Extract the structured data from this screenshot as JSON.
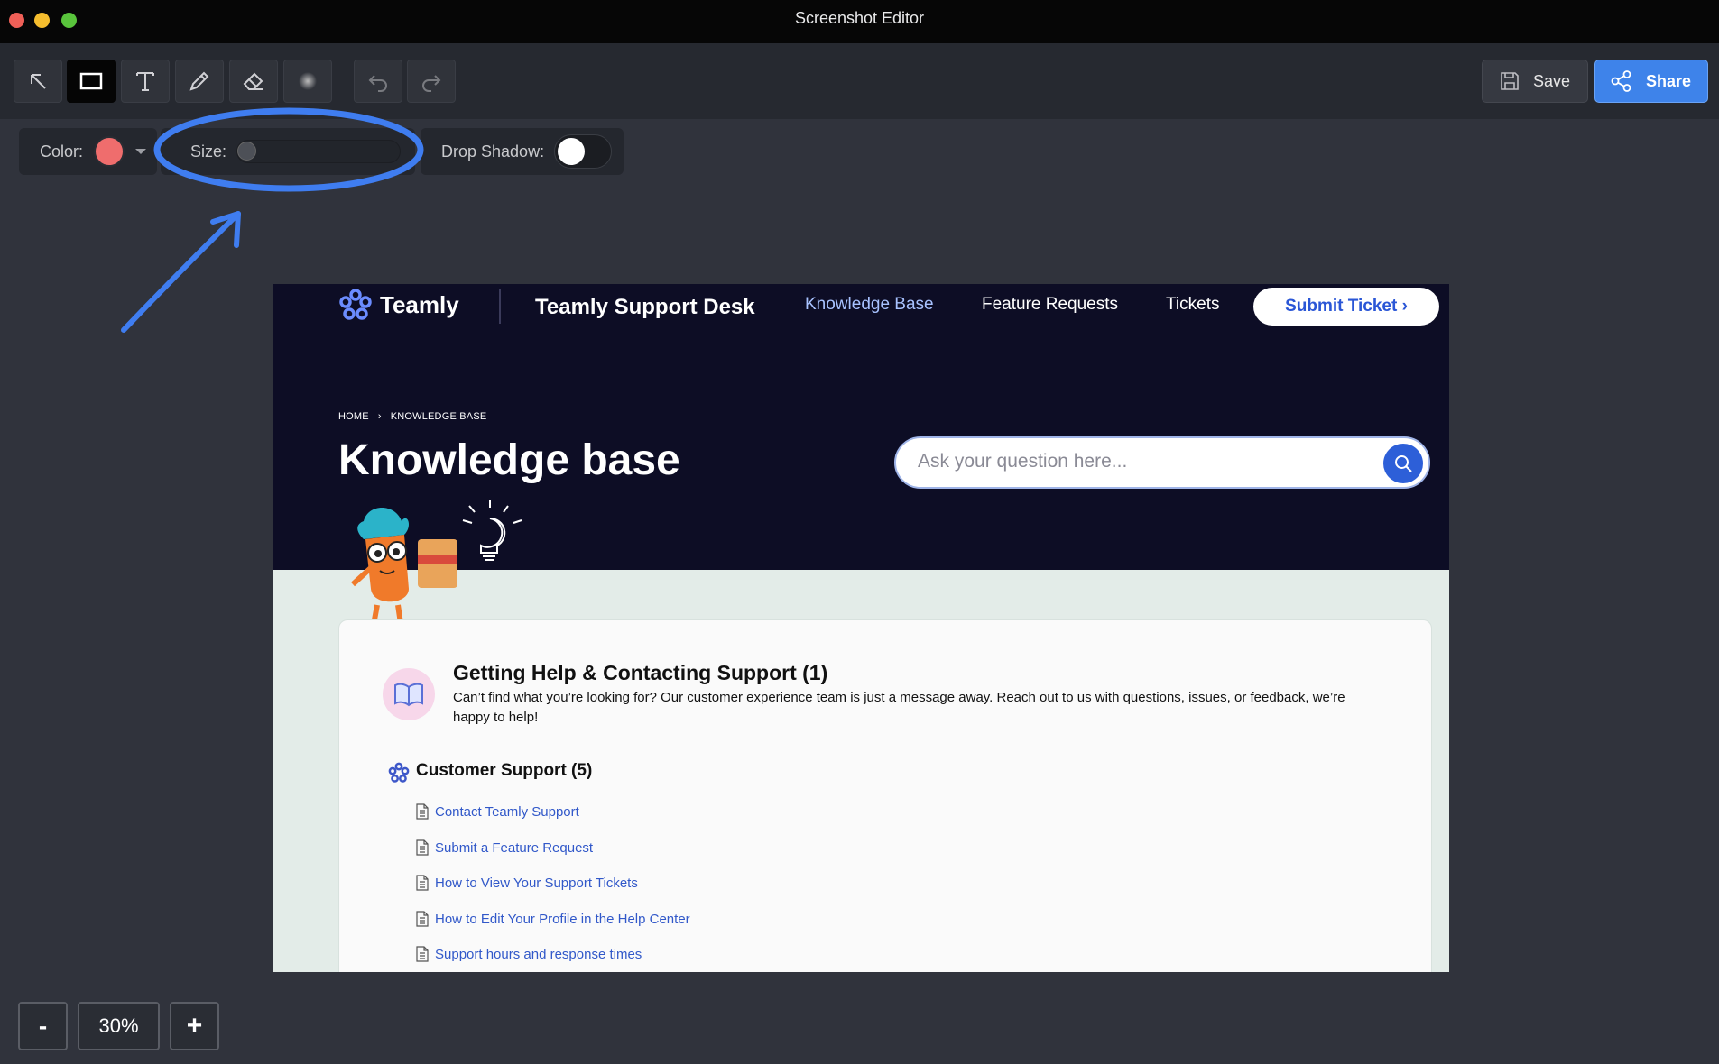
{
  "window": {
    "title": "Screenshot Editor"
  },
  "toolbar": {
    "tools": [
      "arrow-tool",
      "rectangle-tool",
      "text-tool",
      "pencil-tool",
      "eraser-tool",
      "blur-tool"
    ],
    "active_tool": "rectangle-tool",
    "save_label": "Save",
    "share_label": "Share"
  },
  "options": {
    "color_label": "Color:",
    "color_value": "#ef6d6d",
    "size_label": "Size:",
    "size_level": 0,
    "shadow_label": "Drop Shadow:",
    "shadow_on": false
  },
  "annotation": {
    "color": "#3f7df0",
    "shapes": [
      "ellipse",
      "arrow"
    ]
  },
  "site": {
    "logo": "Teamly",
    "title": "Teamly Support Desk",
    "nav": [
      "Knowledge Base",
      "Feature Requests",
      "Tickets"
    ],
    "submit": "Submit Ticket ›",
    "breadcrumb": [
      "HOME",
      "KNOWLEDGE BASE"
    ],
    "heading": "Knowledge base",
    "search_placeholder": "Ask your question here...",
    "category": {
      "title": "Getting Help & Contacting Support (1)",
      "description": "Can’t find what you’re looking for? Our customer experience team is just a message away. Reach out to us with questions, issues, or feedback, we’re happy to help!"
    },
    "section": {
      "title": "Customer Support (5)",
      "articles": [
        "Contact Teamly Support",
        "Submit a Feature Request",
        "How to View Your Support Tickets",
        "How to Edit Your Profile in the Help Center",
        "Support hours and response times"
      ]
    }
  },
  "zoom": {
    "minus": "-",
    "level": "30%",
    "plus": "+"
  }
}
